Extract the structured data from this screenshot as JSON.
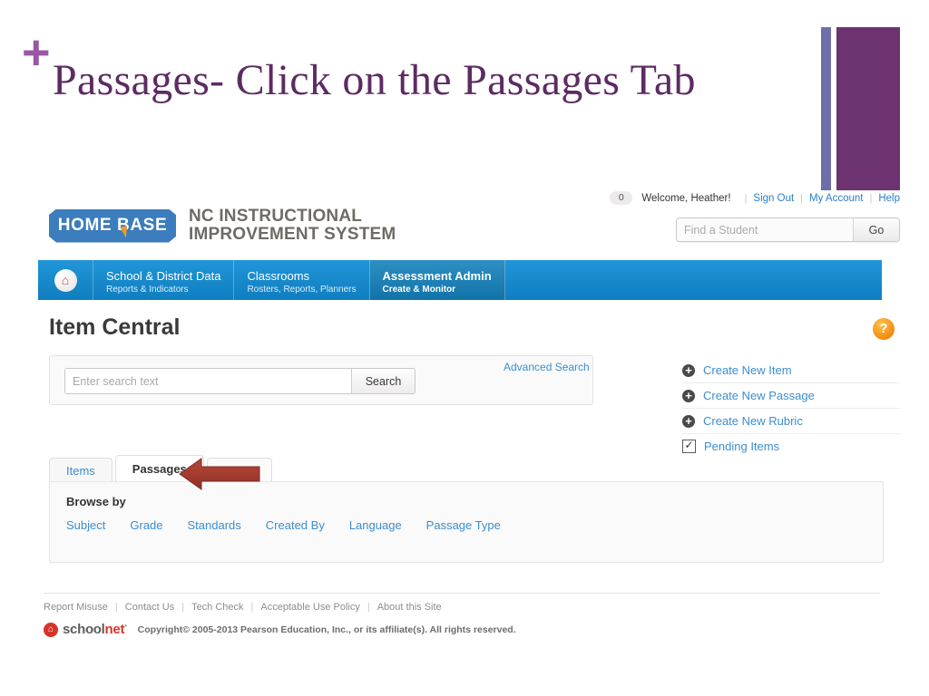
{
  "slide": {
    "plus_mark": "+",
    "title": "Passages- Click on the Passages Tab",
    "accent_purple": "#5d2b63",
    "plus_color": "#9a57a3",
    "bar_thin_color": "#6e6fa8",
    "bar_wide_color": "#6d3371"
  },
  "utility": {
    "count_badge": "0",
    "welcome": "Welcome, Heather!",
    "sign_out": "Sign Out",
    "my_account": "My Account",
    "help": "Help",
    "separator": "|"
  },
  "branding": {
    "logo_text": "HOME BASE",
    "system_line1": "NC INSTRUCTIONAL",
    "system_line2": "IMPROVEMENT SYSTEM",
    "logo_blue": "#3b7dbd"
  },
  "student_search": {
    "placeholder": "Find a Student",
    "value": "",
    "go_label": "Go"
  },
  "nav": {
    "home_icon": "home-icon",
    "items": [
      {
        "title": "School & District Data",
        "subtitle": "Reports & Indicators",
        "active": false
      },
      {
        "title": "Classrooms",
        "subtitle": "Rosters, Reports, Planners",
        "active": false
      },
      {
        "title": "Assessment Admin",
        "subtitle": "Create & Monitor",
        "active": true
      }
    ]
  },
  "page": {
    "title": "Item Central",
    "help_glyph": "?"
  },
  "search": {
    "placeholder": "Enter search text",
    "value": "",
    "button_label": "Search",
    "advanced_label": "Advanced Search"
  },
  "actions": [
    {
      "label": "Create New Item",
      "icon": "plus-circle-icon"
    },
    {
      "label": "Create New Passage",
      "icon": "plus-circle-icon"
    },
    {
      "label": "Create New Rubric",
      "icon": "plus-circle-icon"
    },
    {
      "label": "Pending Items",
      "icon": "checkbox-checked-icon"
    }
  ],
  "tabs": [
    {
      "label": "Items",
      "active": false
    },
    {
      "label": "Passages",
      "active": true
    }
  ],
  "annotation": {
    "arrow_color": "#a93226",
    "arrow_direction": "left"
  },
  "browse": {
    "heading": "Browse by",
    "links": [
      "Subject",
      "Grade",
      "Standards",
      "Created By",
      "Language",
      "Passage Type"
    ]
  },
  "footer": {
    "links": [
      "Report Misuse",
      "Contact Us",
      "Tech Check",
      "Acceptable Use Policy",
      "About this Site"
    ],
    "separator": "|",
    "brand_school": "school",
    "brand_net": "net",
    "brand_tm": "•",
    "copyright": "Copyright© 2005-2013 Pearson Education, Inc., or its affiliate(s). All rights reserved."
  }
}
